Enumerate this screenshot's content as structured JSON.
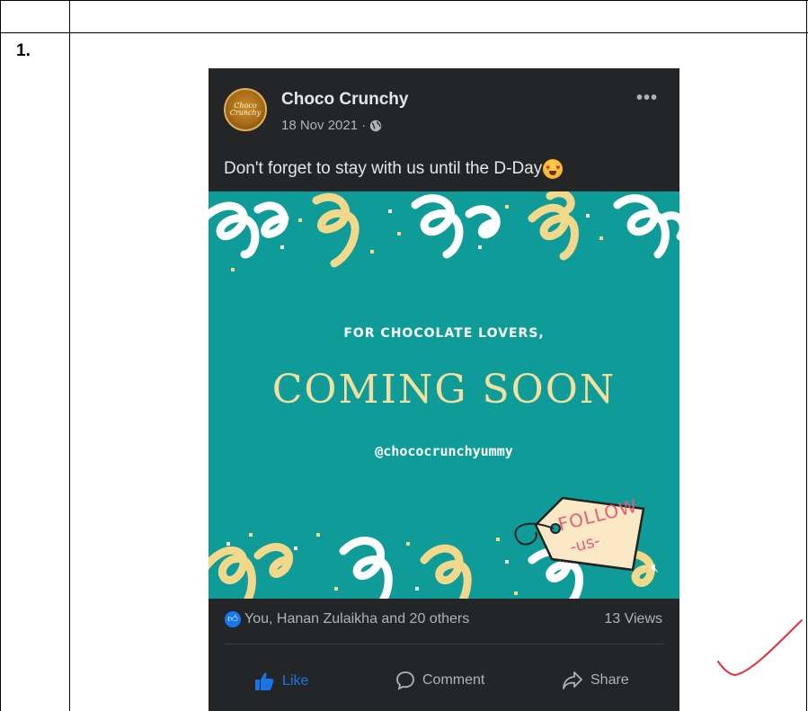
{
  "table": {
    "row_number": "1."
  },
  "post": {
    "page_name": "Choco Crunchy",
    "avatar_text": "Choco\nCrunchy",
    "date": "18 Nov 2021 ·",
    "privacy_icon": "globe-icon",
    "more_icon": "more-options-icon",
    "caption": "Don't forget to stay with us until the D-Day",
    "caption_emoji": "heart-eyes-emoji-icon",
    "image": {
      "subtitle": "FOR CHOCOLATE LOVERS,",
      "title": "COMING SOON",
      "handle": "@chococrunchyummy",
      "tag_line_1": "FOLLOW",
      "tag_line_2": "-us-",
      "colors": {
        "background": "#0f9c98",
        "title": "#f3dfa0",
        "tag_text": "#e85b7a"
      }
    },
    "reactions": {
      "text": "You, Hanan Zulaikha and 20 others",
      "views": "13 Views"
    },
    "actions": {
      "like": "Like",
      "comment": "Comment",
      "share": "Share"
    },
    "colors": {
      "card_bg": "#242526",
      "text": "#e4e6eb",
      "muted": "#b0b3b8",
      "accent": "#1877f2"
    }
  },
  "annotation": {
    "icon": "checkmark-icon",
    "color": "#e0303a"
  }
}
